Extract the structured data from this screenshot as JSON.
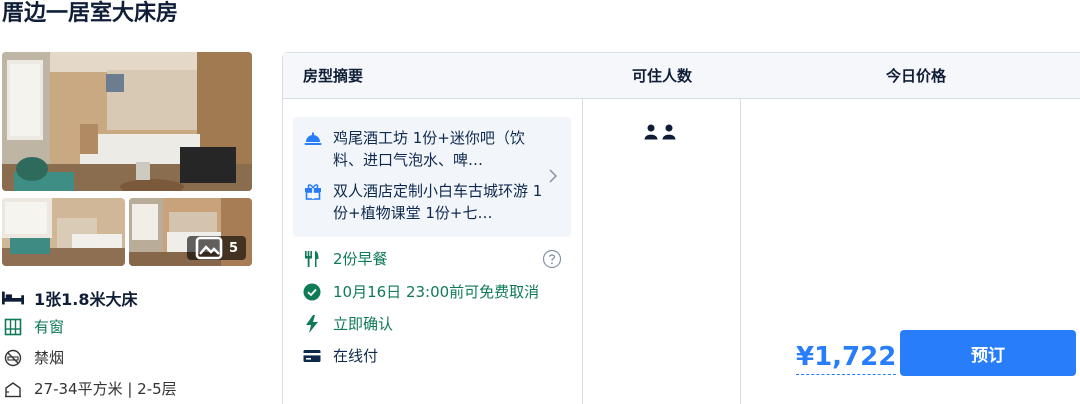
{
  "room": {
    "title": "厝边一居室大床房",
    "photo_count": "5",
    "features": {
      "bed": "1张1.8米大床",
      "window": "有窗",
      "smoking": "禁烟",
      "area": "27-34平方米 | 2-5层"
    }
  },
  "table": {
    "headers": {
      "summary": "房型摘要",
      "guests": "可住人数",
      "price": "今日价格"
    }
  },
  "package": {
    "items": [
      {
        "icon": "cloche-icon",
        "text": "鸡尾酒工坊 1份+迷你吧（饮料、进口气泡水、啤…"
      },
      {
        "icon": "gift-icon",
        "text": "双人酒店定制小白车古城环游 1份+植物课堂 1份+七…"
      }
    ]
  },
  "policies": {
    "breakfast": "2份早餐",
    "cancellation": "10月16日 23:00前可免费取消",
    "confirmation": "立即确认",
    "payment": "在线付"
  },
  "guests": {
    "icon": "two-person-icon"
  },
  "pricing": {
    "price": "¥1,722",
    "book_label": "预订"
  },
  "colors": {
    "accent": "#287dfa",
    "green": "#0f7a56",
    "package_bg": "#f2f6fb"
  }
}
